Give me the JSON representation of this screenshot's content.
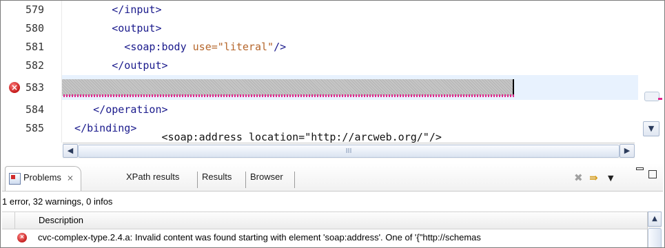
{
  "editor": {
    "lines": [
      {
        "num": "579",
        "code": "        </input>"
      },
      {
        "num": "580",
        "code": "        <output>"
      },
      {
        "num": "581",
        "tag": "          <soap:body ",
        "attr_name": "use=",
        "attr_value": "\"literal\"",
        "tail": "/>"
      },
      {
        "num": "582",
        "code": "        </output>"
      },
      {
        "num": "583",
        "code": "        <soap:address location=\"http://arcweb.org/\"/>",
        "error": true
      },
      {
        "num": "584",
        "code": "     </operation>"
      },
      {
        "num": "585",
        "code": "  </binding>"
      }
    ],
    "error_marker_icon": "error-icon",
    "hscroll_left_icon": "arrow-left-icon",
    "hscroll_thumb_grip": "III",
    "hscroll_right_icon": "arrow-right-icon",
    "vscroll_down_icon": "arrow-down-icon",
    "colors": {
      "error": "#c41a1a",
      "squiggle": "#e0278c",
      "current_line": "#e8f2fe",
      "tag": "#1a1a8c",
      "attribute": "#b5652a"
    }
  },
  "view": {
    "tabs": [
      {
        "label": "Problems",
        "close": "⨯",
        "active": true
      },
      {
        "label": "XPath results"
      },
      {
        "label": "Results"
      },
      {
        "label": "Browser"
      }
    ],
    "toolbar_icons": [
      "clear-icon",
      "filter-icon",
      "view-menu-icon",
      "minimize-icon",
      "maximize-icon"
    ],
    "summary": "1 error, 32 warnings, 0 infos",
    "table": {
      "columns": [
        "Description"
      ],
      "rows": [
        {
          "severity": "error",
          "description": "cvc-complex-type.2.4.a: Invalid content was found starting with element 'soap:address'. One of '{\"http://schemas"
        }
      ]
    }
  }
}
